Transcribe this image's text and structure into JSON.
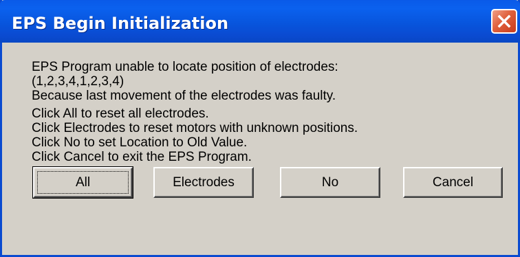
{
  "window": {
    "title": "EPS Begin Initialization",
    "close_icon": "close-x-icon"
  },
  "message": {
    "lines": [
      "EPS Program unable to locate position of electrodes:",
      "(1,2,3,4,1,2,3,4)",
      "Because last movement of the electrodes was faulty.",
      "Click All to reset all electrodes.",
      "Click Electrodes to reset motors with unknown positions.",
      "Click No to set Location  to Old Value.",
      "Click Cancel to exit the EPS Program."
    ]
  },
  "buttons": {
    "all": "All",
    "electrodes": "Electrodes",
    "no": "No",
    "cancel": "Cancel"
  },
  "colors": {
    "titlebar": "#0a4ad0",
    "dialog_face": "#d4d0c8",
    "close_button": "#e0603c"
  }
}
